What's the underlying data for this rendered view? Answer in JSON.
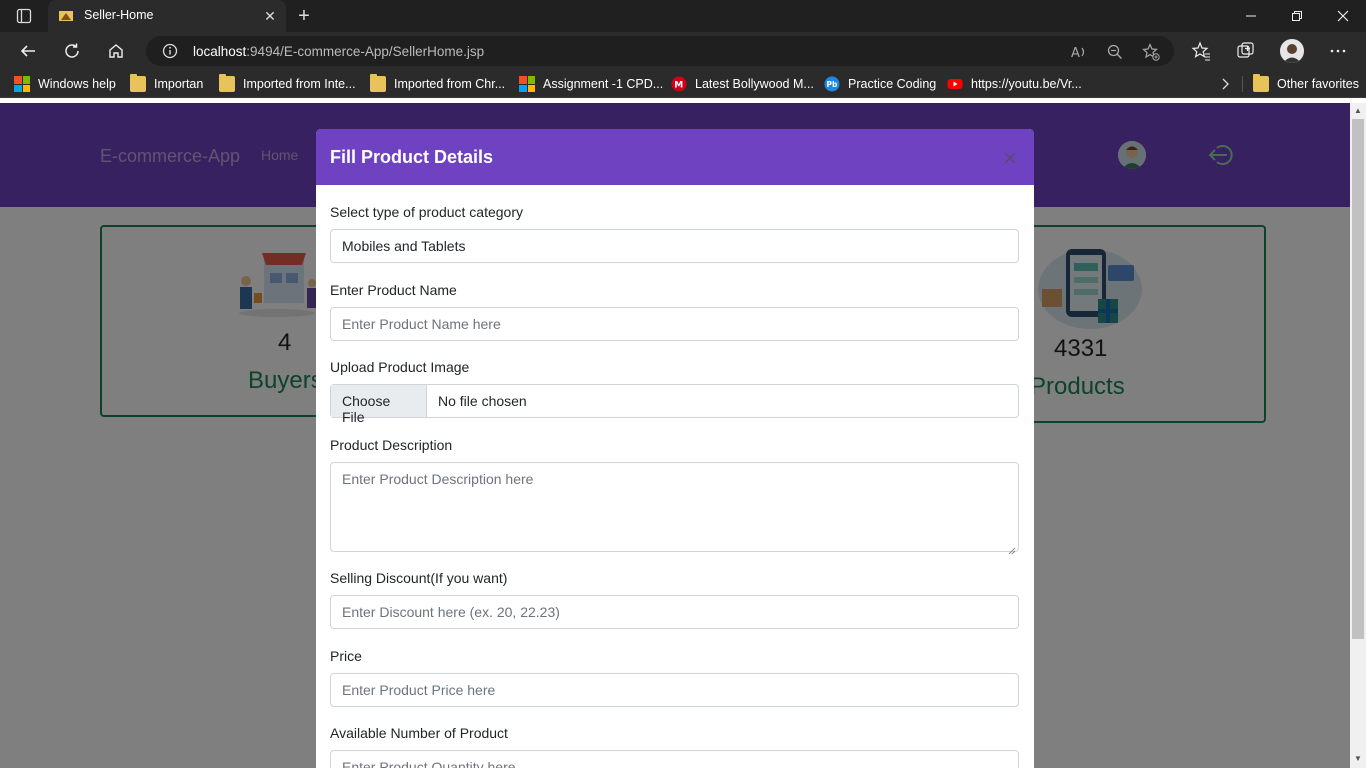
{
  "browser": {
    "tab_title": "Seller-Home",
    "url_host": "localhost",
    "url_rest": ":9494/E-commerce-App/SellerHome.jsp",
    "bookmarks": [
      {
        "label": "Windows help",
        "icon": "ms-logo"
      },
      {
        "label": "Importan",
        "icon": "folder"
      },
      {
        "label": "Imported from Inte...",
        "icon": "folder"
      },
      {
        "label": "Imported from Chr...",
        "icon": "folder"
      },
      {
        "label": "Assignment -1 CPD...",
        "icon": "ms-logo"
      },
      {
        "label": "Latest Bollywood M...",
        "icon": "m-logo"
      },
      {
        "label": "Practice Coding",
        "icon": "pb-logo"
      },
      {
        "label": "https://youtu.be/Vr...",
        "icon": "youtube"
      }
    ],
    "other_favorites": "Other favorites"
  },
  "site": {
    "brand": "E-commerce-App",
    "nav_home": "Home"
  },
  "cards": {
    "buyers_count": "4",
    "buyers_label": "Buyers",
    "products_count": "4331",
    "products_label": "Products"
  },
  "modal": {
    "title": "Fill Product Details",
    "category_label": "Select type of product category",
    "category_value": "Mobiles and Tablets",
    "name_label": "Enter Product Name",
    "name_placeholder": "Enter Product Name here",
    "image_label": "Upload Product Image",
    "file_button": "Choose File",
    "file_status": "No file chosen",
    "description_label": "Product Description",
    "description_placeholder": "Enter Product Description here",
    "discount_label": "Selling Discount(If you want)",
    "discount_placeholder": "Enter Discount here (ex. 20, 22.23)",
    "price_label": "Price",
    "price_placeholder": "Enter Product Price here",
    "quantity_label": "Available Number of Product",
    "quantity_placeholder": "Enter Product Quantity here"
  },
  "colors": {
    "navbar": "#6f42c1",
    "modal_header": "#6f42c1",
    "card_accent": "#198754"
  }
}
